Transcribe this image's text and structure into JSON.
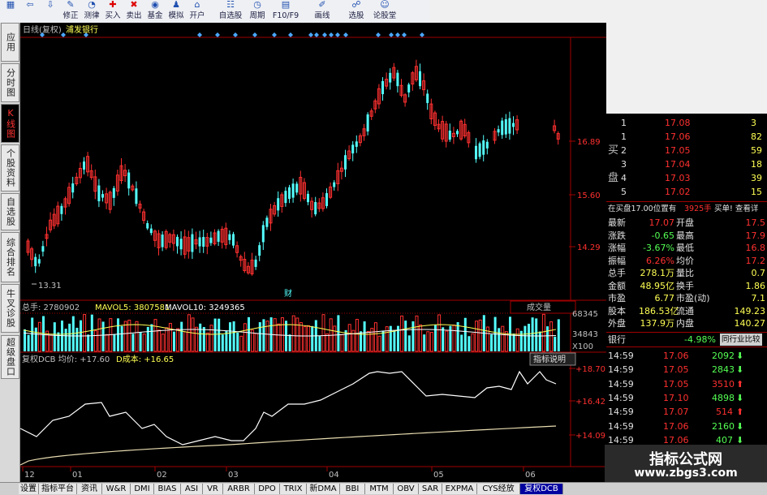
{
  "toolbar": {
    "buttons": [
      {
        "label": "",
        "icon": "windows-icon"
      },
      {
        "label": "",
        "icon": "back-icon"
      },
      {
        "label": "",
        "icon": "down-icon"
      },
      {
        "label": "修正",
        "icon": "edit-icon"
      },
      {
        "label": "测律",
        "icon": "test-icon"
      },
      {
        "label": "买入",
        "icon": "buy-icon"
      },
      {
        "label": "卖出",
        "icon": "sell-icon"
      },
      {
        "label": "基金",
        "icon": "fund-icon"
      },
      {
        "label": "模拟",
        "icon": "simulate-icon"
      },
      {
        "label": "开户",
        "icon": "account-icon"
      },
      {
        "label": "自选股",
        "icon": "watchlist-icon"
      },
      {
        "label": "周期",
        "icon": "period-icon"
      },
      {
        "label": "F10/F9",
        "icon": "f10-icon"
      },
      {
        "label": "画线",
        "icon": "draw-icon"
      },
      {
        "label": "选股",
        "icon": "select-stock-icon"
      },
      {
        "label": "论股堂",
        "icon": "forum-icon"
      }
    ]
  },
  "left_tabs": [
    "应用",
    "分时图",
    "K线图",
    "个股资料",
    "自选股",
    "综合排名",
    "牛叉诊股",
    "超级盘口"
  ],
  "chart": {
    "header": {
      "period": "日线(复权)",
      "stock": "浦发银行"
    },
    "price_axis": [
      "16.89",
      "15.60",
      "14.29"
    ],
    "low_marker": "13.31",
    "event_label": "财",
    "volume": {
      "total_label": "总手: 2780902",
      "ma5_label": "MAVOL5: 3807581",
      "ma10_label": "MAVOL10: 3249365",
      "indicator_button": "成交量",
      "axis": [
        "68345",
        "34843",
        "X100"
      ]
    },
    "dcb": {
      "name_label": "复权DCB 均价: +17.60",
      "cost_label": "D成本: +16.65",
      "explain_button": "指标说明",
      "axis": [
        "+18.70",
        "+16.42",
        "+14.09"
      ]
    },
    "x_axis": [
      "12",
      "01",
      "02",
      "03",
      "04",
      "05",
      "06"
    ]
  },
  "order_book": [
    {
      "side": "",
      "level": "1",
      "price": "17.08",
      "vol": "3"
    },
    {
      "side": "",
      "level": "1",
      "price": "17.06",
      "vol": "82"
    },
    {
      "side": "买",
      "level": "2",
      "price": "17.05",
      "vol": "59"
    },
    {
      "side": "",
      "level": "3",
      "price": "17.04",
      "vol": "18"
    },
    {
      "side": "盘",
      "level": "4",
      "price": "17.03",
      "vol": "39"
    },
    {
      "side": "",
      "level": "5",
      "price": "17.02",
      "vol": "15"
    }
  ],
  "buy_info": {
    "text": "在买盘17.00位置有",
    "amount": "3925手",
    "link": "买单! 查看详"
  },
  "quote": [
    [
      "最新",
      "17.07",
      "开盘",
      "17.5"
    ],
    [
      "涨跌",
      "-0.65",
      "最高",
      "17.9"
    ],
    [
      "涨幅",
      "-3.67%",
      "最低",
      "16.8"
    ],
    [
      "振幅",
      "6.26%",
      "均价",
      "17.2"
    ],
    [
      "总手",
      "278.1万",
      "量比",
      "0.7"
    ],
    [
      "金额",
      "48.95亿",
      "换手",
      "1.86"
    ],
    [
      "市盈",
      "6.77",
      "市盈(动)",
      "7.1"
    ],
    [
      "股本",
      "186.53亿",
      "流通",
      "149.23"
    ],
    [
      "外盘",
      "137.9万",
      "内盘",
      "140.27"
    ]
  ],
  "industry": {
    "name": "银行",
    "pct": "-4.98%",
    "button": "同行业比较"
  },
  "trades": [
    {
      "time": "14:59",
      "price": "17.06",
      "vol": "2092",
      "dir": "down"
    },
    {
      "time": "14:59",
      "price": "17.05",
      "vol": "2843",
      "dir": "down"
    },
    {
      "time": "14:59",
      "price": "17.05",
      "vol": "3510",
      "dir": "up"
    },
    {
      "time": "14:59",
      "price": "17.10",
      "vol": "4898",
      "dir": "down"
    },
    {
      "time": "14:59",
      "price": "17.07",
      "vol": "514",
      "dir": "up"
    },
    {
      "time": "14:59",
      "price": "17.06",
      "vol": "2160",
      "dir": "down"
    },
    {
      "time": "14:59",
      "price": "17.06",
      "vol": "407",
      "dir": "down"
    }
  ],
  "watermark": {
    "title": "指标公式网",
    "url": "www.zbgs3.com"
  },
  "bottom_tabs": [
    "设置",
    "指标平台",
    "资讯",
    "W&R",
    "DMI",
    "BIAS",
    "ASI",
    "VR",
    "ARBR",
    "DPO",
    "TRIX",
    "新DMA",
    "BBI",
    "MTM",
    "OBV",
    "SAR",
    "EXPMA",
    "CYS经放",
    "复权DCB"
  ],
  "colors": {
    "up": "#ff3030",
    "down": "#54ffff",
    "yellow": "#ffff54",
    "grid_red": "#a00000"
  }
}
